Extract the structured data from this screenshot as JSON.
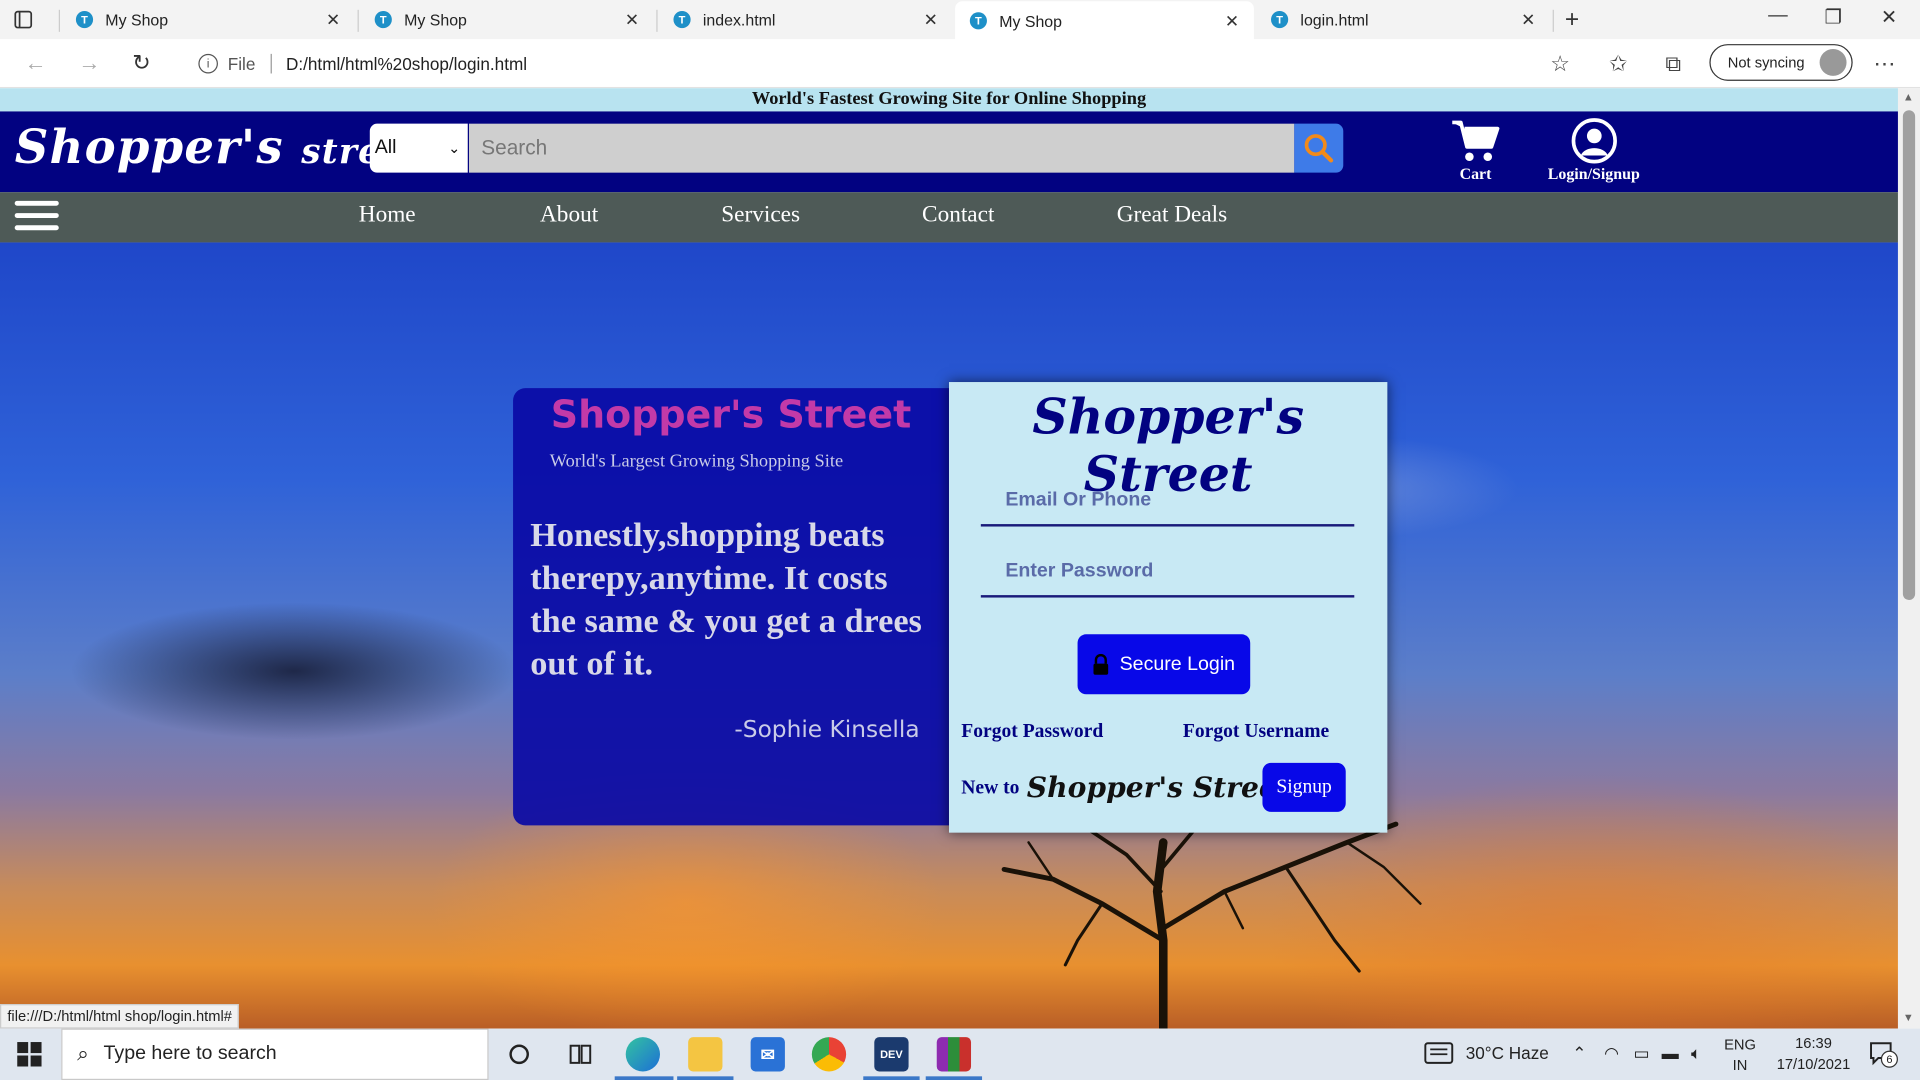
{
  "browser": {
    "tabs": [
      {
        "label": "My Shop"
      },
      {
        "label": "My Shop"
      },
      {
        "label": "index.html"
      },
      {
        "label": "My Shop"
      },
      {
        "label": "login.html"
      }
    ],
    "address": {
      "file_label": "File",
      "url": "D:/html/html%20shop/login.html"
    },
    "sync_label": "Not syncing"
  },
  "page": {
    "announcement": "World's Fastest Growing Site for Online Shopping",
    "logo": {
      "main": "Shopper's",
      "small": "street"
    },
    "category_select": "All",
    "search_placeholder": "Search",
    "cart_label": "Cart",
    "login_signup_label": "Login/Signup",
    "nav": [
      "Home",
      "About",
      "Services",
      "Contact",
      "Great Deals"
    ],
    "info_card": {
      "title": "Shopper's Street",
      "subtitle": "World's Largest Growing Shopping Site",
      "quote": "Honestly,shopping beats therepy,anytime. It costs the same & you get a drees out of it.",
      "author": "-Sophie Kinsella"
    },
    "login_card": {
      "title": "Shopper's Street",
      "email_placeholder": "Email Or Phone",
      "password_placeholder": "Enter Password",
      "login_button": "Secure Login",
      "forgot_password": "Forgot Password",
      "forgot_username": "Forgot Username",
      "new_to": "New to",
      "brand": "Shopper's Street",
      "question": "?",
      "signup_button": "Signup"
    },
    "status_url": "file:///D:/html/html shop/login.html#"
  },
  "taskbar": {
    "search_placeholder": "Type here to search",
    "weather": "30°C  Haze",
    "lang_top": "ENG",
    "lang_bottom": "IN",
    "time": "16:39",
    "date": "17/10/2021",
    "notification_count": "6"
  },
  "colors": {
    "header_bg": "#020281",
    "nav_bg": "#4e5a57",
    "announce_bg": "#b8e3f0",
    "button_blue": "#0808e8",
    "search_btn": "#3e7be8",
    "info_title": "#c23aa8"
  }
}
